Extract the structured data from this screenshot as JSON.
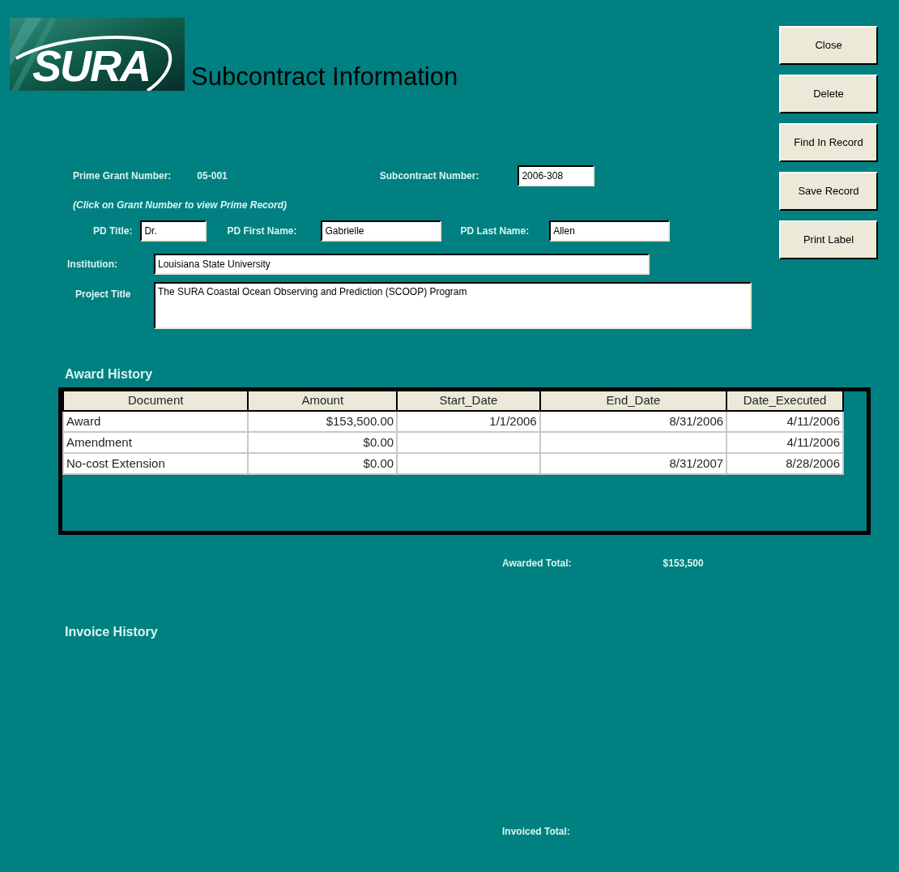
{
  "logo": {
    "text": "SURA"
  },
  "title": "Subcontract Information",
  "buttons": [
    {
      "label": "Close"
    },
    {
      "label": "Delete"
    },
    {
      "label": "Find In Record"
    },
    {
      "label": "Save Record"
    },
    {
      "label": "Print Label"
    }
  ],
  "prime_grant": {
    "label": "Prime Grant Number:",
    "value": "05-001"
  },
  "subcontract": {
    "label": "Subcontract Number:",
    "value": "2006-308"
  },
  "note": "(Click on Grant Number to view Prime Record)",
  "pd_fields": [
    {
      "label": "PD Title:",
      "value": "Dr."
    },
    {
      "label": "PD First Name:",
      "value": "Gabrielle"
    },
    {
      "label": "PD Last Name:",
      "value": "Allen"
    }
  ],
  "institution": {
    "label": "Institution:",
    "value": "Louisiana State University"
  },
  "project_title": {
    "label": "Project Title",
    "value": "The SURA Coastal Ocean Observing and Prediction (SCOOP) Program"
  },
  "award_history": {
    "heading": "Award History",
    "columns": [
      "Document",
      "Amount",
      "Start_Date",
      "End_Date",
      "Date_Executed"
    ],
    "rows": [
      [
        "Award",
        "$153,500.00",
        "1/1/2006",
        "8/31/2006",
        "4/11/2006"
      ],
      [
        "Amendment",
        "$0.00",
        null,
        null,
        "4/11/2006"
      ],
      [
        "No-cost Extension",
        "$0.00",
        null,
        "8/31/2007",
        "8/28/2006"
      ]
    ]
  },
  "awarded_total": {
    "label": "Awarded Total:",
    "value": "$153,500"
  },
  "invoice_history": {
    "heading": "Invoice History"
  },
  "invoiced_total": {
    "label": "Invoiced Total:"
  }
}
